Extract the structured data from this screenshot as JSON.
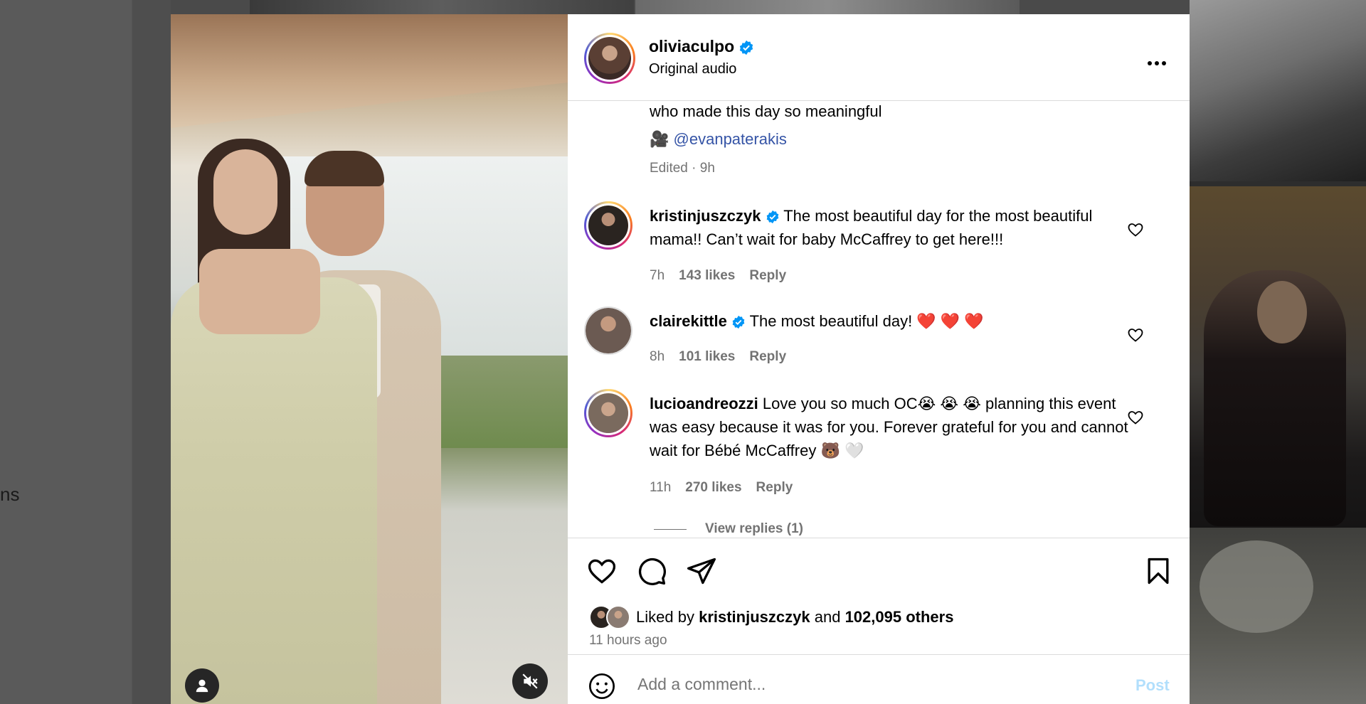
{
  "background": {
    "sidebar_partial_text": "ns"
  },
  "post": {
    "author": "oliviaculpo",
    "audio": "Original audio",
    "caption_cut_line": "who made this day so meaningful",
    "caption_mention_emoji": "🎥",
    "caption_mention": "@evanpaterakis",
    "caption_meta": "Edited · 9h"
  },
  "comments": [
    {
      "username": "kristinjuszczyk",
      "verified": true,
      "text": "The most beautiful day for the most beautiful mama!! Can’t wait for baby McCaffrey to get here!!!",
      "time": "7h",
      "likes": "143 likes",
      "reply": "Reply",
      "avatar_color": "#2a2420"
    },
    {
      "username": "clairekittle",
      "verified": true,
      "text": "The most beautiful day! ",
      "emoji": "❤️ ❤️ ❤️",
      "time": "8h",
      "likes": "101 likes",
      "reply": "Reply",
      "avatar_color": "#6b5a52"
    },
    {
      "username": "lucioandreozzi",
      "verified": false,
      "text": "Love you so much OC😭 😭 😭 planning this event was easy because it was for you. Forever grateful for you and cannot wait for Bébé McCaffrey 🐻 🤍",
      "time": "11h",
      "likes": "270 likes",
      "reply": "Reply",
      "avatar_color": "#7a6a5e",
      "view_replies": "View replies (1)"
    }
  ],
  "actions": {
    "liked_by_prefix": "Liked by ",
    "liked_by_user": "kristinjuszczyk",
    "liked_by_and": " and ",
    "liked_by_others": "102,095 others",
    "time_ago": "11 hours ago"
  },
  "comment_box": {
    "placeholder": "Add a comment...",
    "post_label": "Post"
  },
  "colors": {
    "verified": "#0095f6",
    "link": "#3554a6",
    "secondary_text": "#737373",
    "post_button_disabled": "#b2dffc"
  },
  "icons": [
    "verified-icon",
    "more-icon",
    "heart-icon",
    "comment-icon",
    "share-icon",
    "bookmark-icon",
    "smiley-icon",
    "user-icon",
    "mute-icon"
  ]
}
